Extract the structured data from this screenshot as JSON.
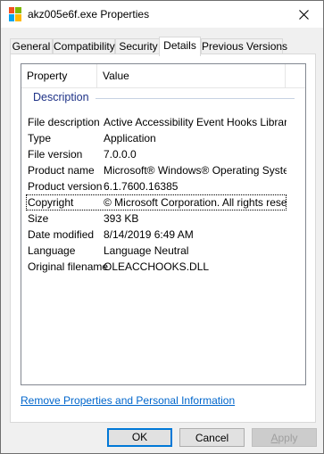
{
  "window": {
    "title": "akz005e6f.exe Properties",
    "accent": "#0078d7"
  },
  "tabs": [
    {
      "label": "General",
      "active": false
    },
    {
      "label": "Compatibility",
      "active": false
    },
    {
      "label": "Security",
      "active": false
    },
    {
      "label": "Details",
      "active": true
    },
    {
      "label": "Previous Versions",
      "active": false
    }
  ],
  "details": {
    "columns": {
      "property": "Property",
      "value": "Value"
    },
    "group": "Description",
    "rows": [
      {
        "property": "File description",
        "value": "Active Accessibility Event Hooks Library"
      },
      {
        "property": "Type",
        "value": "Application"
      },
      {
        "property": "File version",
        "value": "7.0.0.0"
      },
      {
        "property": "Product name",
        "value": "Microsoft® Windows® Operating System"
      },
      {
        "property": "Product version",
        "value": "6.1.7600.16385"
      },
      {
        "property": "Copyright",
        "value": "© Microsoft Corporation. All rights reserv..."
      },
      {
        "property": "Size",
        "value": "393 KB"
      },
      {
        "property": "Date modified",
        "value": "8/14/2019 6:49 AM"
      },
      {
        "property": "Language",
        "value": "Language Neutral"
      },
      {
        "property": "Original filename",
        "value": "OLEACCHOOKS.DLL"
      }
    ]
  },
  "link": "Remove Properties and Personal Information",
  "buttons": {
    "ok": "OK",
    "cancel": "Cancel",
    "apply_first": "A",
    "apply_rest": "pply"
  },
  "icons": {
    "app": "shield-exe-icon",
    "close": "close-icon"
  }
}
